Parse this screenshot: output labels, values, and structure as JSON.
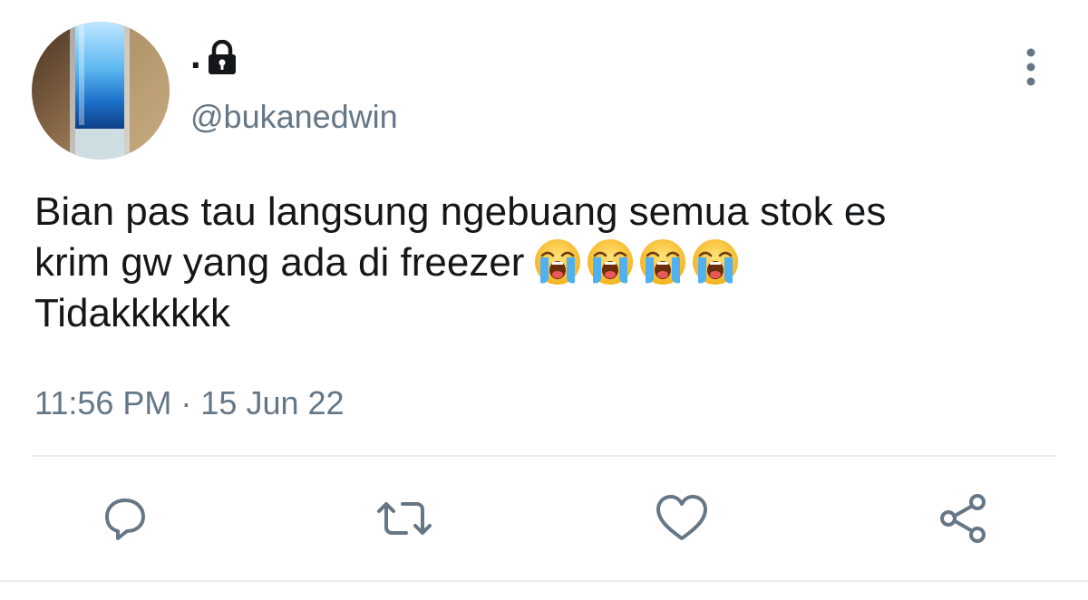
{
  "user": {
    "display_name": ".",
    "handle": "@bukanedwin",
    "avatar_icon": "blue-drink-glass-avatar",
    "lock_icon": "lock-icon"
  },
  "tweet": {
    "line1": "Bian pas tau langsung ngebuang semua stok es",
    "line2": "krim gw yang ada di freezer",
    "line3": "Tidakkkkkk",
    "emoji": "loudly-crying-face",
    "emoji_count": 4,
    "timestamp": "11:56 PM · 15 Jun 22"
  },
  "actions": [
    {
      "name": "reply-icon"
    },
    {
      "name": "retweet-icon"
    },
    {
      "name": "like-icon"
    },
    {
      "name": "share-icon"
    }
  ],
  "colors": {
    "text": "#14171a",
    "secondary": "#657786",
    "divider": "#e6ecf0"
  }
}
